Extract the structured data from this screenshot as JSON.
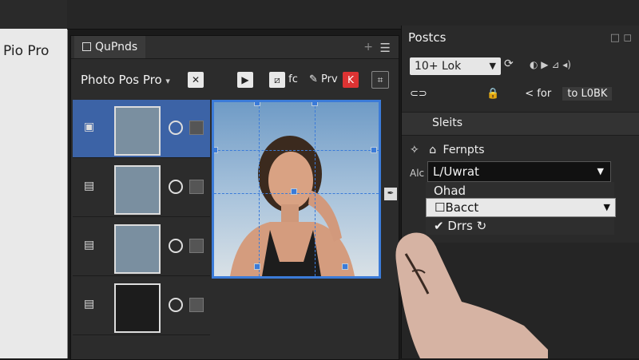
{
  "left_panel": {
    "label": "Pio Pro"
  },
  "layers_panel": {
    "tab_label": "QuPnds",
    "toolbar": {
      "title": "Photo Pos Pro",
      "btn1_label": "",
      "btn2_label": "fc",
      "btn3_label": "Prv"
    },
    "layers": [
      {
        "selected": true,
        "thumb": "photo"
      },
      {
        "selected": false,
        "thumb": "photo"
      },
      {
        "selected": false,
        "thumb": "checker"
      },
      {
        "selected": false,
        "thumb": "dark"
      }
    ]
  },
  "properties_panel": {
    "tab_label": "Postcs",
    "preset_select": "10+ Lok",
    "search_label": "< for",
    "search_value": "to L0BK",
    "section_header": "Sleits",
    "prop_label": "Fernpts",
    "align_label": "Alc",
    "dropdown_value": "L/Uwrat",
    "options": [
      "Ohad",
      "Bacct",
      "Drrs"
    ]
  },
  "colors": {
    "accent": "#3b7bd8",
    "panel": "#2c2c2c",
    "selected_row": "#3c63a6"
  }
}
